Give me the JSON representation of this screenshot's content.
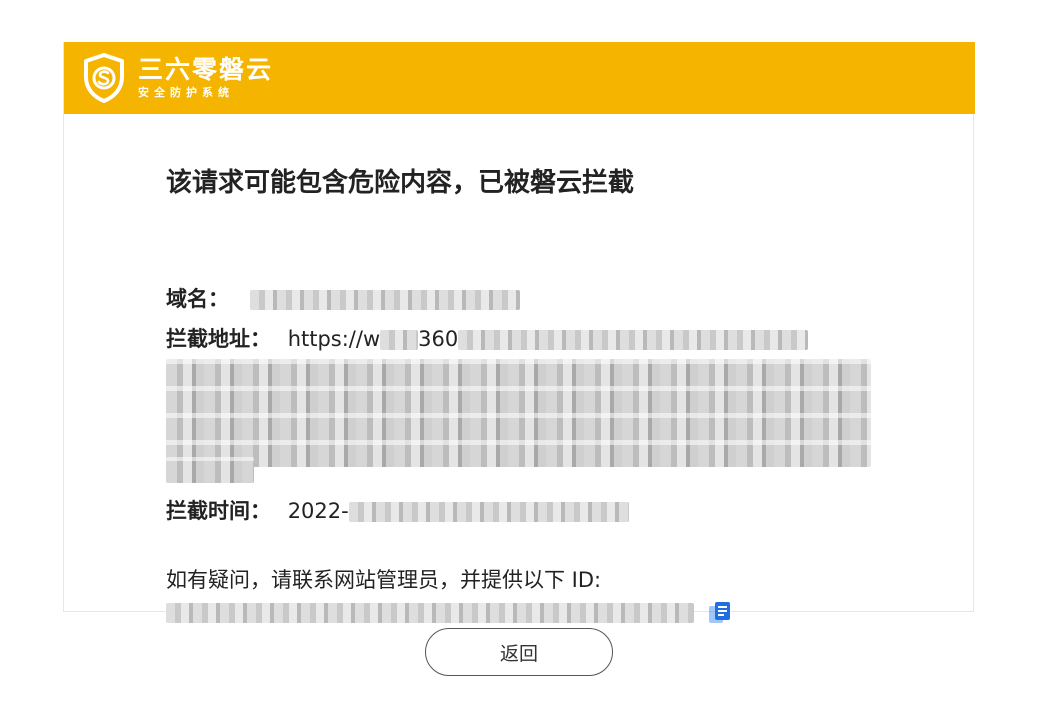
{
  "brand": {
    "name": "三六零磐云",
    "subtitle": "安全防护系统",
    "header_color": "#f5b400",
    "logo_icon": "shield-s-icon"
  },
  "notice": {
    "title": "该请求可能包含危险内容，已被磐云拦截",
    "domain_label": "域名：",
    "url_label": "拦截地址：",
    "url_visible_prefix": "https://w",
    "url_visible_mid": "360",
    "time_label": "拦截时间：",
    "time_visible_prefix": "2022-",
    "contact_text": "如有疑问，请联系网站管理员，并提供以下 ID:",
    "copy_icon": "copy-icon"
  },
  "actions": {
    "back_label": "返回"
  }
}
